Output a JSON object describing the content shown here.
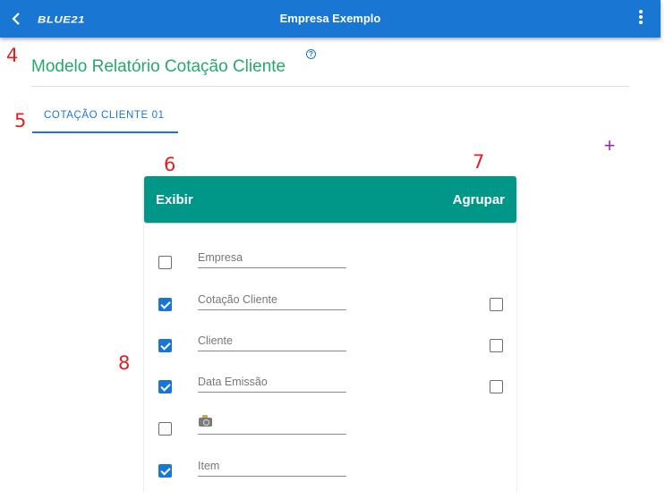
{
  "appbar": {
    "logo": "BLUE21",
    "title": "Empresa Exemplo",
    "back_icon": "chevron-left-icon",
    "menu_icon": "more-vertical-icon"
  },
  "annotations": [
    "4",
    "5",
    "6",
    "7",
    "8"
  ],
  "page": {
    "title": "Modelo Relatório Cotação Cliente",
    "help_icon": "?"
  },
  "tabs": [
    {
      "label": "COTAÇÃO CLIENTE 01",
      "active": true
    }
  ],
  "add_button": "+",
  "card": {
    "header": {
      "show_label": "Exibir",
      "group_label": "Agrupar"
    },
    "rows": [
      {
        "label": "Empresa",
        "show": false,
        "group": null
      },
      {
        "label": "Cotação Cliente",
        "show": true,
        "group": false
      },
      {
        "label": "Cliente",
        "show": true,
        "group": false
      },
      {
        "label": "Data Emissão",
        "show": true,
        "group": false
      },
      {
        "label": "",
        "icon": "camera-icon",
        "show": false,
        "group": null
      },
      {
        "label": "Item",
        "show": true,
        "group": null
      }
    ]
  },
  "colors": {
    "appbar": "#1976d2",
    "title": "#26a96c",
    "card_header": "#009688",
    "checkbox": "#1976d2",
    "add_button": "#9c27b0",
    "annotation": "#e02020"
  }
}
